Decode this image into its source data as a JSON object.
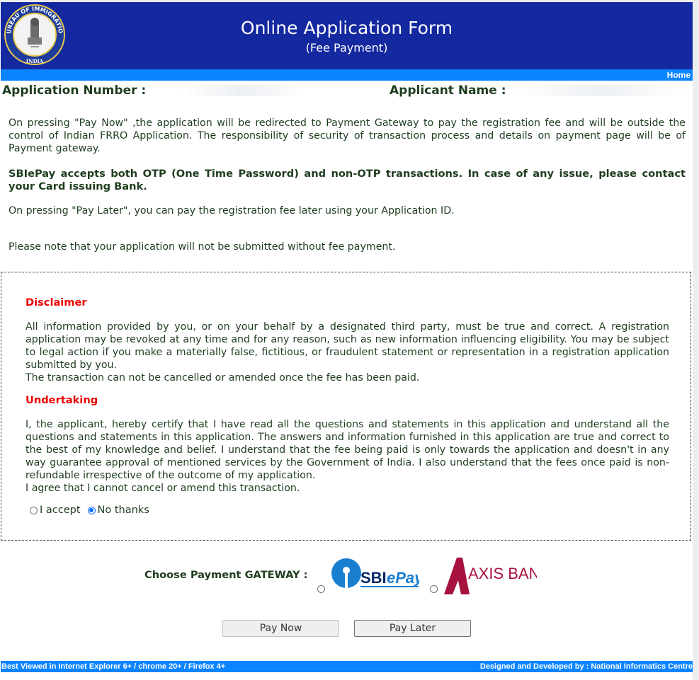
{
  "header": {
    "title": "Online Application Form",
    "subtitle": "(Fee Payment)",
    "logo": {
      "icon": "bureau-of-immigration-emblem-icon",
      "top_text": "BUREAU OF IMMIGRATION",
      "bottom_text": "INDIA"
    }
  },
  "nav": {
    "home_label": "Home"
  },
  "applicant": {
    "number_label": "Application Number :",
    "number_value": "",
    "name_label": "Applicant Name :",
    "name_value": ""
  },
  "notes": {
    "pay_now_note": "On pressing \"Pay Now\" ,the application will be redirected to Payment Gateway to pay the registration fee and will be outside the control of Indian FRRO Application. The responsibility of security of transaction process and details on payment page will be of Payment gateway.",
    "sbi_note": "SBIePay accepts both OTP (One Time Password) and non-OTP transactions. In case of any issue, please contact your Card issuing Bank.",
    "pay_later_note": "On pressing \"Pay Later\", you can pay the registration fee later using your Application ID.",
    "submit_note": "Please note that your application will not be submitted without fee payment."
  },
  "disclaimer": {
    "title": "Disclaimer",
    "text": "All information provided by you, or on your behalf by a designated third party, must be true and correct. A registration application may be revoked at any time and for any reason, such as new information influencing eligibility. You may be subject to legal action if you make a materially false, fictitious, or fraudulent statement or representation in a registration application submitted by you.",
    "text2": "The transaction can not be cancelled or amended once the fee has been paid."
  },
  "undertaking": {
    "title": "Undertaking",
    "text": "I, the applicant, hereby certify that I have read all the questions and statements in this application and understand all the questions and statements in this application. The answers and information furnished in this application are true and correct to the best of my knowledge and belief. I understand that the fee being paid is only towards the application and doesn't in any way guarantee approval of mentioned services by the Government of India. I also understand that the fees once paid is non-refundable irrespective of the outcome of my application.",
    "text2": "I agree that I cannot cancel or amend this transaction.",
    "options": [
      {
        "label": "I accept",
        "checked": false
      },
      {
        "label": "No thanks",
        "checked": true
      }
    ]
  },
  "gateway": {
    "label": "Choose Payment GATEWAY :",
    "options": [
      {
        "name": "SBIePay",
        "logo_text_sbi": "SBI",
        "logo_text_epay": "ePay",
        "checked": false,
        "color": "#1b7fd1"
      },
      {
        "name": "AXIS BANK",
        "logo_text": "AXIS BANK",
        "checked": false,
        "color": "#a8123e"
      }
    ]
  },
  "buttons": {
    "pay_now": "Pay Now",
    "pay_later": "Pay Later"
  },
  "footer": {
    "left": "Best Viewed in Internet Explorer 6+ / chrome 20+ / Firefox 4+",
    "right": "Designed and Developed by : National Informatics Centre"
  },
  "colors": {
    "header_bg": "#1428a0",
    "bar_bg": "#0a84ff",
    "section_title": "#ee0000",
    "text": "#1f3d1f"
  }
}
